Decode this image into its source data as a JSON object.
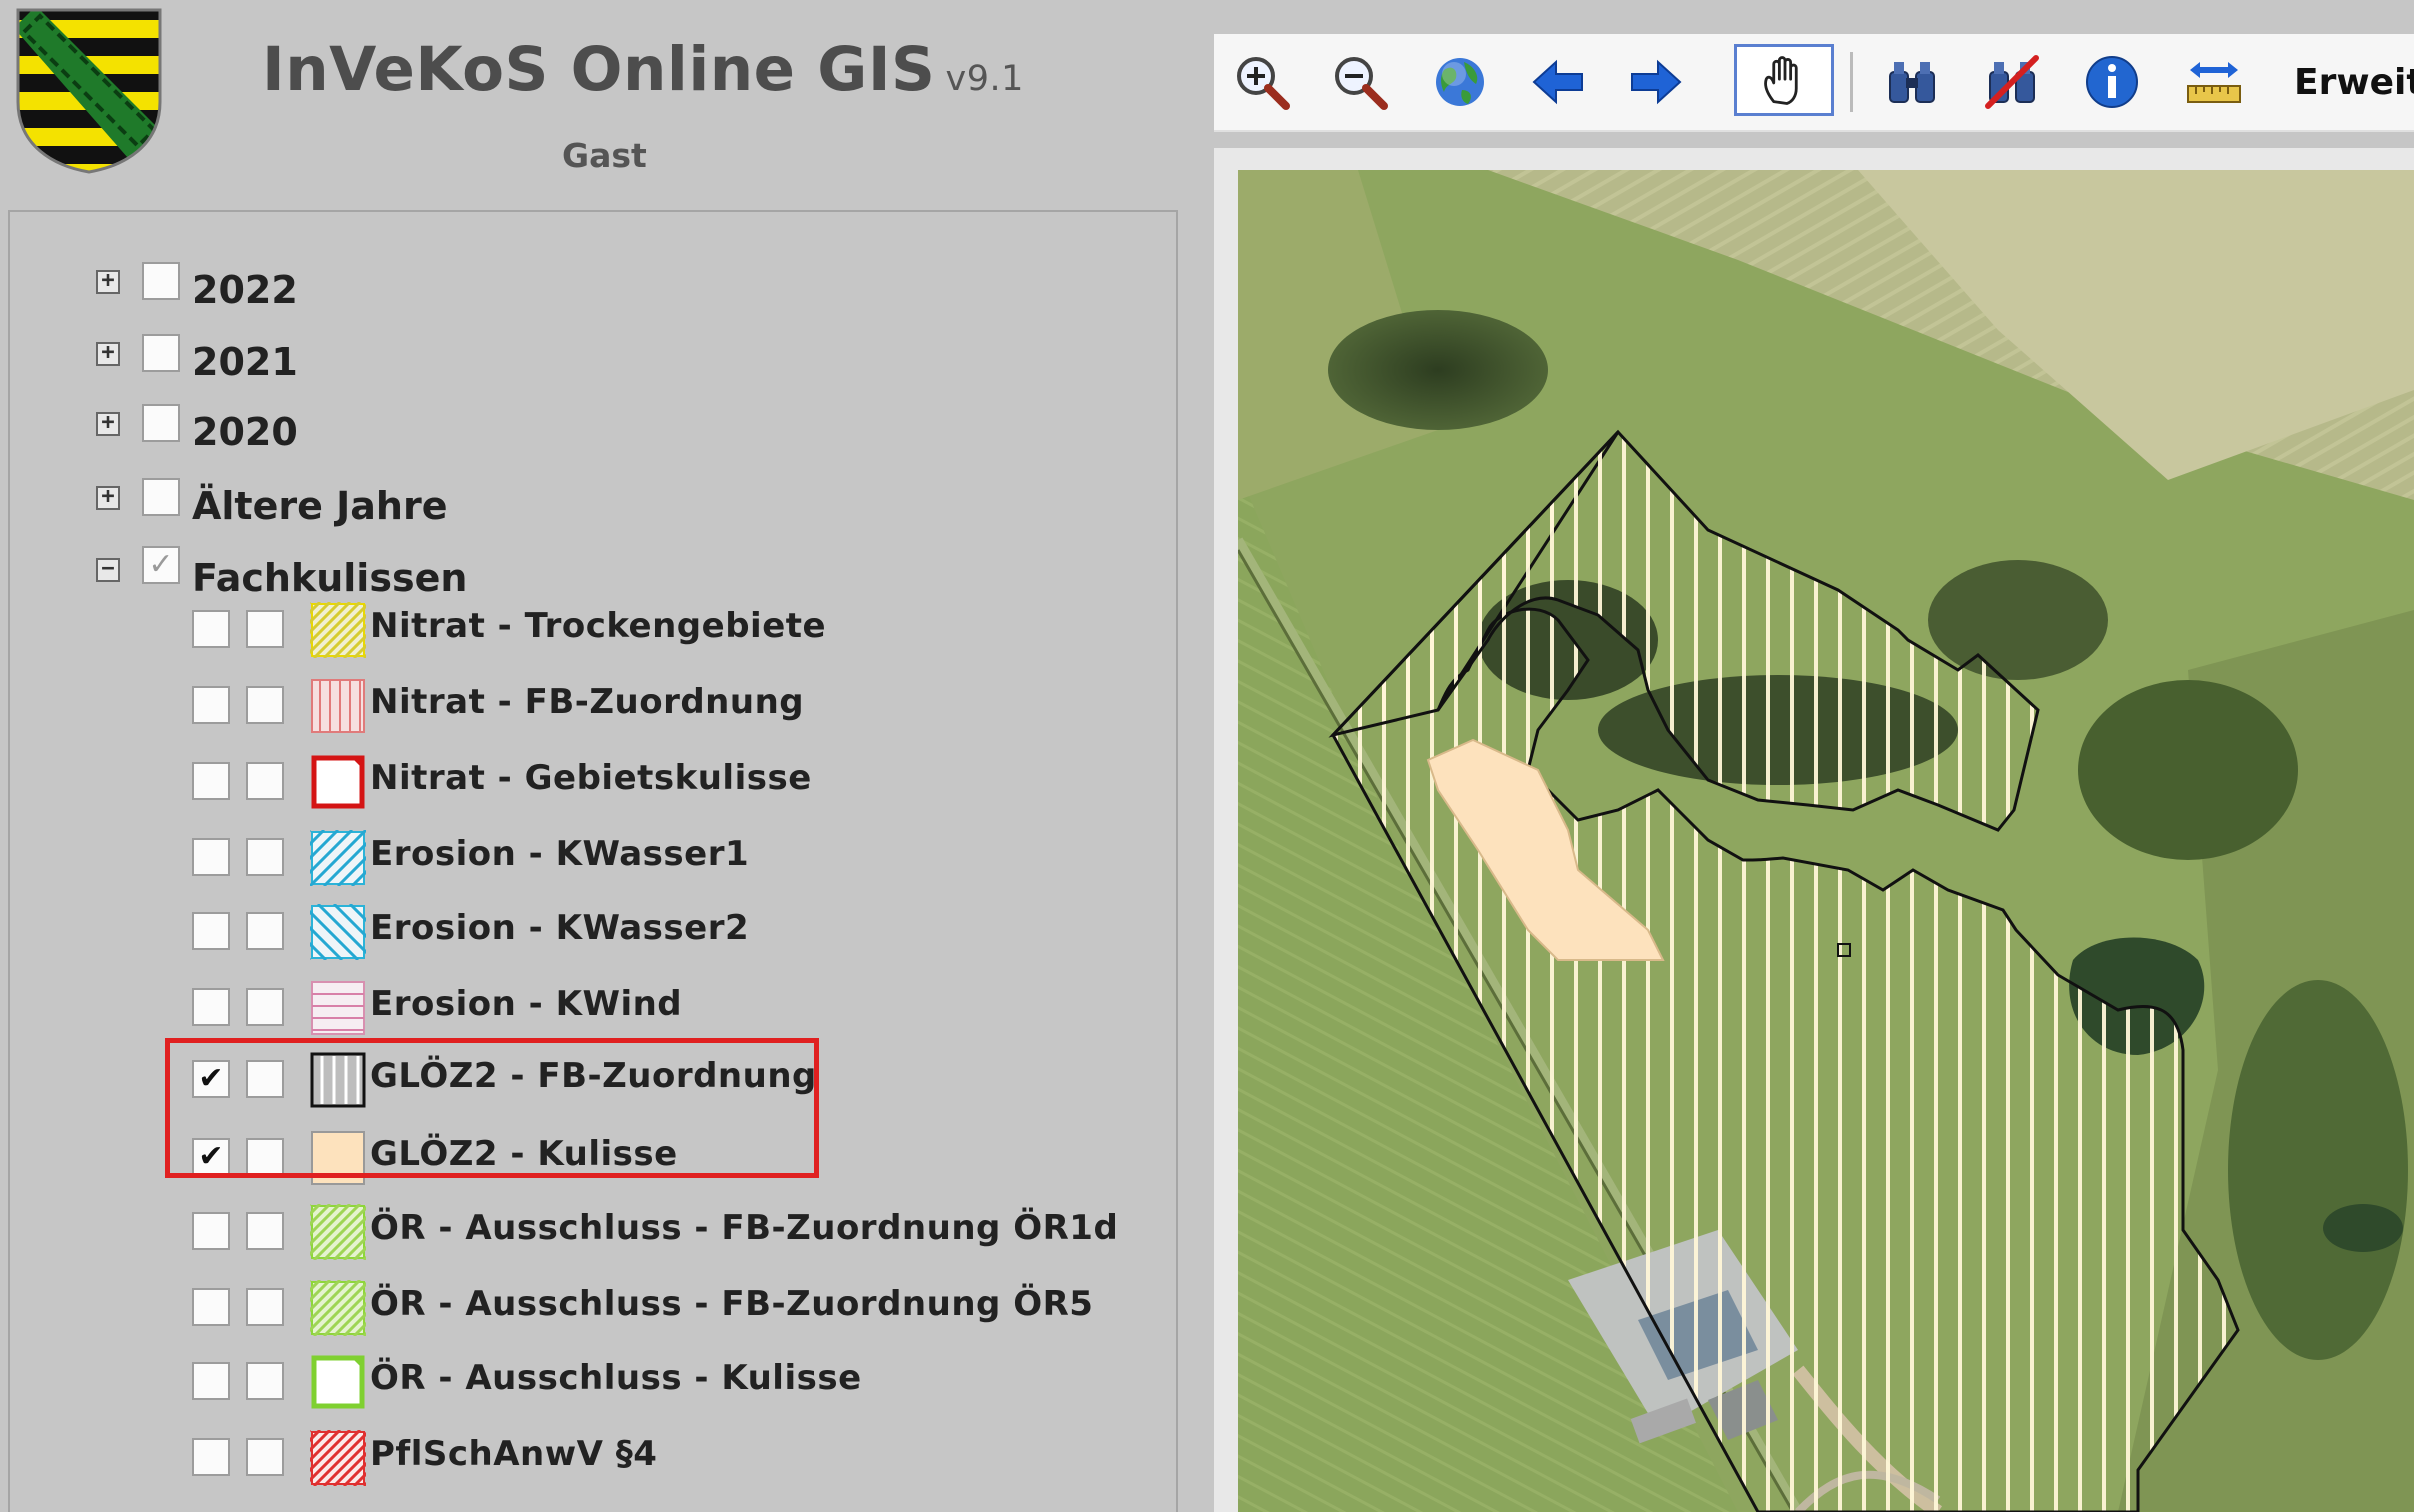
{
  "header": {
    "title": "InVeKoS Online GIS",
    "version": "v9.1",
    "user": "Gast"
  },
  "tree": {
    "years": [
      {
        "label": "2022",
        "expander": "+",
        "checked": false
      },
      {
        "label": "2021",
        "expander": "+",
        "checked": false
      },
      {
        "label": "2020",
        "expander": "+",
        "checked": false
      },
      {
        "label": "Ältere Jahre",
        "expander": "+",
        "checked": false
      }
    ],
    "fachkulissen": {
      "label": "Fachkulissen",
      "expander": "−",
      "checked": true
    },
    "layers": [
      {
        "label": "Nitrat - Trockengebiete",
        "visible": false,
        "selectable": false,
        "swatch": "diag-yellow"
      },
      {
        "label": "Nitrat - FB-Zuordnung",
        "visible": false,
        "selectable": false,
        "swatch": "vert-red"
      },
      {
        "label": "Nitrat - Gebietskulisse",
        "visible": false,
        "selectable": false,
        "swatch": "outline-red"
      },
      {
        "label": "Erosion - KWasser1",
        "visible": false,
        "selectable": false,
        "swatch": "diag-cyan"
      },
      {
        "label": "Erosion - KWasser2",
        "visible": false,
        "selectable": false,
        "swatch": "diag-cyan-rev"
      },
      {
        "label": "Erosion - KWind",
        "visible": false,
        "selectable": false,
        "swatch": "horiz-pink"
      },
      {
        "label": "GLÖZ2 - FB-Zuordnung",
        "visible": true,
        "selectable": false,
        "swatch": "vert-white"
      },
      {
        "label": "GLÖZ2 - Kulisse",
        "visible": true,
        "selectable": false,
        "swatch": "fill-peach"
      },
      {
        "label": "ÖR - Ausschluss - FB-Zuordnung ÖR1d",
        "visible": false,
        "selectable": false,
        "swatch": "diag-green"
      },
      {
        "label": "ÖR - Ausschluss - FB-Zuordnung ÖR5",
        "visible": false,
        "selectable": false,
        "swatch": "diag-green"
      },
      {
        "label": "ÖR - Ausschluss - Kulisse",
        "visible": false,
        "selectable": false,
        "swatch": "outline-green"
      },
      {
        "label": "PflSchAnwV §4",
        "visible": false,
        "selectable": false,
        "swatch": "diag-red"
      }
    ],
    "check_mark": "✔",
    "grey_check_mark": "✓"
  },
  "toolbar": {
    "tools": [
      {
        "name": "zoom-in-icon",
        "tooltip": ""
      },
      {
        "name": "zoom-out-icon",
        "tooltip": ""
      },
      {
        "name": "globe-icon",
        "tooltip": ""
      },
      {
        "name": "back-arrow-icon",
        "tooltip": ""
      },
      {
        "name": "forward-arrow-icon",
        "tooltip": ""
      },
      {
        "name": "pan-hand-icon",
        "tooltip": ""
      },
      {
        "name": "binoculars-icon",
        "tooltip": ""
      },
      {
        "name": "binoculars-off-icon",
        "tooltip": ""
      },
      {
        "name": "info-icon",
        "tooltip": ""
      },
      {
        "name": "measure-ruler-icon",
        "tooltip": ""
      }
    ],
    "active_tool": "pan-hand-icon",
    "extended_label": "Erweit"
  },
  "colors": {
    "background": "#c6c6c6",
    "highlight": "#e02020",
    "kulisse_fill": "#fde2bd",
    "accent_active": "#5a7fd0"
  }
}
